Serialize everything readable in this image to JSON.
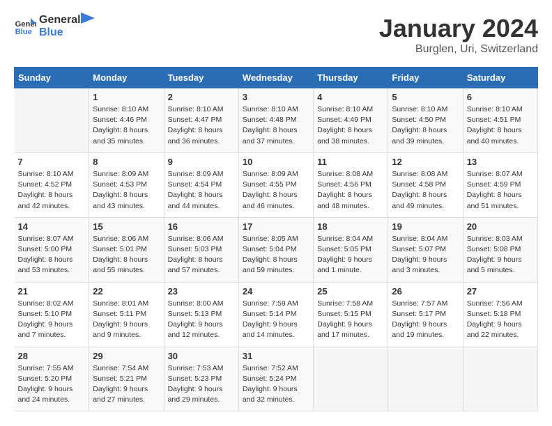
{
  "header": {
    "logo_general": "General",
    "logo_blue": "Blue",
    "month_title": "January 2024",
    "location": "Burglen, Uri, Switzerland"
  },
  "weekdays": [
    "Sunday",
    "Monday",
    "Tuesday",
    "Wednesday",
    "Thursday",
    "Friday",
    "Saturday"
  ],
  "weeks": [
    [
      {
        "day": "",
        "info": ""
      },
      {
        "day": "1",
        "info": "Sunrise: 8:10 AM\nSunset: 4:46 PM\nDaylight: 8 hours\nand 35 minutes."
      },
      {
        "day": "2",
        "info": "Sunrise: 8:10 AM\nSunset: 4:47 PM\nDaylight: 8 hours\nand 36 minutes."
      },
      {
        "day": "3",
        "info": "Sunrise: 8:10 AM\nSunset: 4:48 PM\nDaylight: 8 hours\nand 37 minutes."
      },
      {
        "day": "4",
        "info": "Sunrise: 8:10 AM\nSunset: 4:49 PM\nDaylight: 8 hours\nand 38 minutes."
      },
      {
        "day": "5",
        "info": "Sunrise: 8:10 AM\nSunset: 4:50 PM\nDaylight: 8 hours\nand 39 minutes."
      },
      {
        "day": "6",
        "info": "Sunrise: 8:10 AM\nSunset: 4:51 PM\nDaylight: 8 hours\nand 40 minutes."
      }
    ],
    [
      {
        "day": "7",
        "info": "Sunrise: 8:10 AM\nSunset: 4:52 PM\nDaylight: 8 hours\nand 42 minutes."
      },
      {
        "day": "8",
        "info": "Sunrise: 8:09 AM\nSunset: 4:53 PM\nDaylight: 8 hours\nand 43 minutes."
      },
      {
        "day": "9",
        "info": "Sunrise: 8:09 AM\nSunset: 4:54 PM\nDaylight: 8 hours\nand 44 minutes."
      },
      {
        "day": "10",
        "info": "Sunrise: 8:09 AM\nSunset: 4:55 PM\nDaylight: 8 hours\nand 46 minutes."
      },
      {
        "day": "11",
        "info": "Sunrise: 8:08 AM\nSunset: 4:56 PM\nDaylight: 8 hours\nand 48 minutes."
      },
      {
        "day": "12",
        "info": "Sunrise: 8:08 AM\nSunset: 4:58 PM\nDaylight: 8 hours\nand 49 minutes."
      },
      {
        "day": "13",
        "info": "Sunrise: 8:07 AM\nSunset: 4:59 PM\nDaylight: 8 hours\nand 51 minutes."
      }
    ],
    [
      {
        "day": "14",
        "info": "Sunrise: 8:07 AM\nSunset: 5:00 PM\nDaylight: 8 hours\nand 53 minutes."
      },
      {
        "day": "15",
        "info": "Sunrise: 8:06 AM\nSunset: 5:01 PM\nDaylight: 8 hours\nand 55 minutes."
      },
      {
        "day": "16",
        "info": "Sunrise: 8:06 AM\nSunset: 5:03 PM\nDaylight: 8 hours\nand 57 minutes."
      },
      {
        "day": "17",
        "info": "Sunrise: 8:05 AM\nSunset: 5:04 PM\nDaylight: 8 hours\nand 59 minutes."
      },
      {
        "day": "18",
        "info": "Sunrise: 8:04 AM\nSunset: 5:05 PM\nDaylight: 9 hours\nand 1 minute."
      },
      {
        "day": "19",
        "info": "Sunrise: 8:04 AM\nSunset: 5:07 PM\nDaylight: 9 hours\nand 3 minutes."
      },
      {
        "day": "20",
        "info": "Sunrise: 8:03 AM\nSunset: 5:08 PM\nDaylight: 9 hours\nand 5 minutes."
      }
    ],
    [
      {
        "day": "21",
        "info": "Sunrise: 8:02 AM\nSunset: 5:10 PM\nDaylight: 9 hours\nand 7 minutes."
      },
      {
        "day": "22",
        "info": "Sunrise: 8:01 AM\nSunset: 5:11 PM\nDaylight: 9 hours\nand 9 minutes."
      },
      {
        "day": "23",
        "info": "Sunrise: 8:00 AM\nSunset: 5:13 PM\nDaylight: 9 hours\nand 12 minutes."
      },
      {
        "day": "24",
        "info": "Sunrise: 7:59 AM\nSunset: 5:14 PM\nDaylight: 9 hours\nand 14 minutes."
      },
      {
        "day": "25",
        "info": "Sunrise: 7:58 AM\nSunset: 5:15 PM\nDaylight: 9 hours\nand 17 minutes."
      },
      {
        "day": "26",
        "info": "Sunrise: 7:57 AM\nSunset: 5:17 PM\nDaylight: 9 hours\nand 19 minutes."
      },
      {
        "day": "27",
        "info": "Sunrise: 7:56 AM\nSunset: 5:18 PM\nDaylight: 9 hours\nand 22 minutes."
      }
    ],
    [
      {
        "day": "28",
        "info": "Sunrise: 7:55 AM\nSunset: 5:20 PM\nDaylight: 9 hours\nand 24 minutes."
      },
      {
        "day": "29",
        "info": "Sunrise: 7:54 AM\nSunset: 5:21 PM\nDaylight: 9 hours\nand 27 minutes."
      },
      {
        "day": "30",
        "info": "Sunrise: 7:53 AM\nSunset: 5:23 PM\nDaylight: 9 hours\nand 29 minutes."
      },
      {
        "day": "31",
        "info": "Sunrise: 7:52 AM\nSunset: 5:24 PM\nDaylight: 9 hours\nand 32 minutes."
      },
      {
        "day": "",
        "info": ""
      },
      {
        "day": "",
        "info": ""
      },
      {
        "day": "",
        "info": ""
      }
    ]
  ]
}
